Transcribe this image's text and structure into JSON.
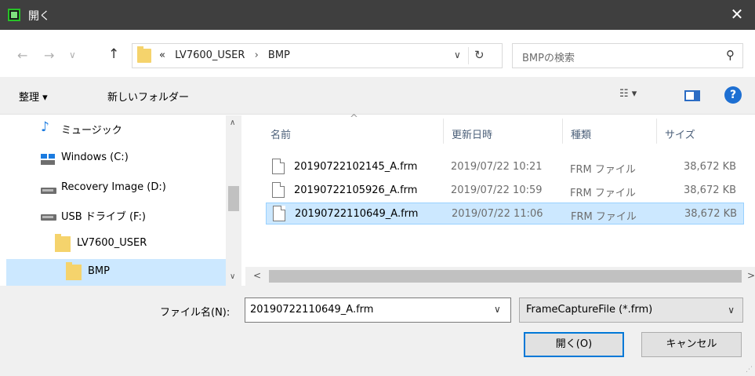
{
  "window": {
    "title": "開く",
    "close_glyph": "✕"
  },
  "nav": {
    "back_glyph": "←",
    "forward_glyph": "→",
    "recent_glyph": "∨",
    "up_glyph": "↑",
    "address": {
      "prefix": "«",
      "segments": [
        "LV7600_USER",
        "BMP"
      ],
      "separator": "›",
      "dropdown_glyph": "∨",
      "refresh_glyph": "↻"
    },
    "search": {
      "placeholder": "BMPの検索",
      "icon_glyph": "⚲"
    }
  },
  "toolbar": {
    "organize": "整理 ▾",
    "new_folder": "新しいフォルダー",
    "view_glyph": "☷ ▾",
    "help": "?"
  },
  "nav_pane": {
    "items": [
      {
        "label": "ミュージック",
        "icon": "music-icon"
      },
      {
        "label": "Windows (C:)",
        "icon": "windows-drive-icon"
      },
      {
        "label": "Recovery Image (D:)",
        "icon": "drive-icon"
      },
      {
        "label": "USB ドライブ (F:)",
        "icon": "usb-drive-icon"
      },
      {
        "label": "LV7600_USER",
        "icon": "folder-icon"
      },
      {
        "label": "BMP",
        "icon": "folder-icon",
        "selected": true
      }
    ],
    "scroll_up_glyph": "∧",
    "scroll_down_glyph": "∨"
  },
  "file_list": {
    "columns": [
      "名前",
      "更新日時",
      "種類",
      "サイズ"
    ],
    "sort_glyph": "^",
    "rows": [
      {
        "name": "20190722102145_A.frm",
        "date": "2019/07/22 10:21",
        "type": "FRM ファイル",
        "size": "38,672 KB",
        "selected": false
      },
      {
        "name": "20190722105926_A.frm",
        "date": "2019/07/22 10:59",
        "type": "FRM ファイル",
        "size": "38,672 KB",
        "selected": false
      },
      {
        "name": "20190722110649_A.frm",
        "date": "2019/07/22 11:06",
        "type": "FRM ファイル",
        "size": "38,672 KB",
        "selected": true
      }
    ],
    "hscroll_left_glyph": "<",
    "hscroll_right_glyph": ">"
  },
  "bottom": {
    "filename_label": "ファイル名(N):",
    "filename_value": "20190722110649_A.frm",
    "filename_dropdown_glyph": "∨",
    "filter_value": "FrameCaptureFile (*.frm)",
    "filter_dropdown_glyph": "∨",
    "open_button": "開く(O)",
    "cancel_button": "キャンセル"
  }
}
